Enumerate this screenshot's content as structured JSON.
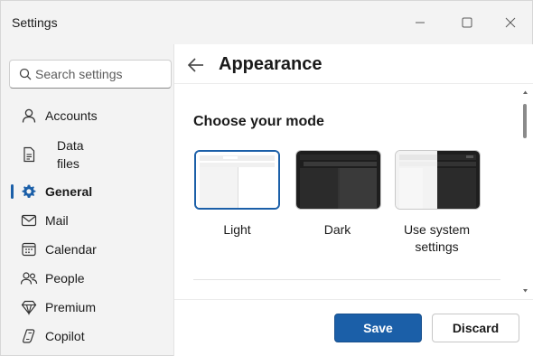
{
  "window": {
    "title": "Settings",
    "controls": [
      "minimize-icon",
      "maximize-icon",
      "close-icon"
    ]
  },
  "sidebar": {
    "search": {
      "placeholder": "Search settings",
      "value": "",
      "icon": "search-icon"
    },
    "items": [
      {
        "label": "Accounts",
        "icon": "person-icon",
        "active": false
      },
      {
        "label_line1": "Data",
        "label_line2": "files",
        "icon": "document-icon",
        "active": false
      },
      {
        "label": "General",
        "icon": "gear-icon",
        "active": true
      },
      {
        "label": "Mail",
        "icon": "mail-icon",
        "active": false
      },
      {
        "label": "Calendar",
        "icon": "calendar-icon",
        "active": false
      },
      {
        "label": "People",
        "icon": "people-icon",
        "active": false
      },
      {
        "label": "Premium",
        "icon": "diamond-icon",
        "active": false
      },
      {
        "label": "Copilot",
        "icon": "copilot-icon",
        "active": false
      }
    ]
  },
  "main": {
    "back_icon": "back-arrow-icon",
    "title": "Appearance",
    "section_title": "Choose your mode",
    "modes": [
      {
        "label_line1": "Light",
        "label_line2": "",
        "selected": true
      },
      {
        "label_line1": "Dark",
        "label_line2": "",
        "selected": false
      },
      {
        "label_line1": "Use system",
        "label_line2": "settings",
        "selected": false
      }
    ]
  },
  "footer": {
    "save_label": "Save",
    "discard_label": "Discard"
  },
  "colors": {
    "accent": "#1b5fa8",
    "background": "#f3f3f3",
    "panel": "#ffffff"
  }
}
